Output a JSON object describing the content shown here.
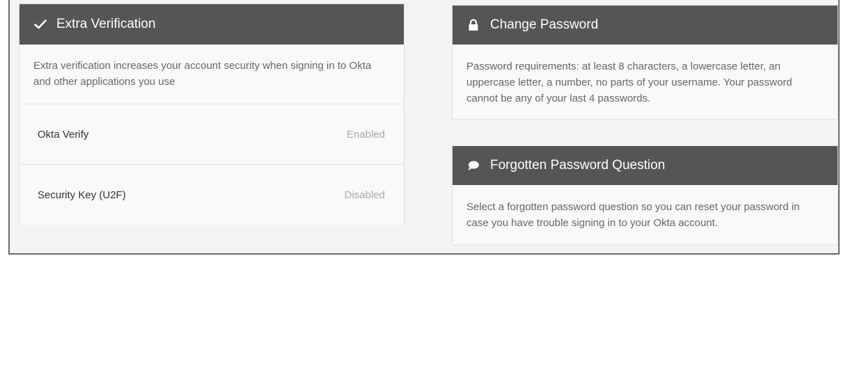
{
  "extra_verification": {
    "title": "Extra Verification",
    "icon": "checkmark-icon",
    "description": "Extra verification increases your account security when signing in to Okta and other applications you use",
    "factors": [
      {
        "name": "Okta Verify",
        "status": "Enabled"
      },
      {
        "name": "Security Key (U2F)",
        "status": "Disabled"
      }
    ]
  },
  "change_password": {
    "title": "Change Password",
    "icon": "lock-icon",
    "description": "Password requirements: at least 8 characters, a lowercase letter, an uppercase letter, a number, no parts of your username. Your password cannot be any of your last 4 passwords."
  },
  "forgotten_question": {
    "title": "Forgotten Password Question",
    "icon": "speech-bubble-icon",
    "description": "Select a forgotten password question so you can reset your password in case you have trouble signing in to your Okta account."
  },
  "colors": {
    "header_bg": "#555555",
    "header_text": "#ffffff",
    "status_text": "#a8a8a8"
  }
}
